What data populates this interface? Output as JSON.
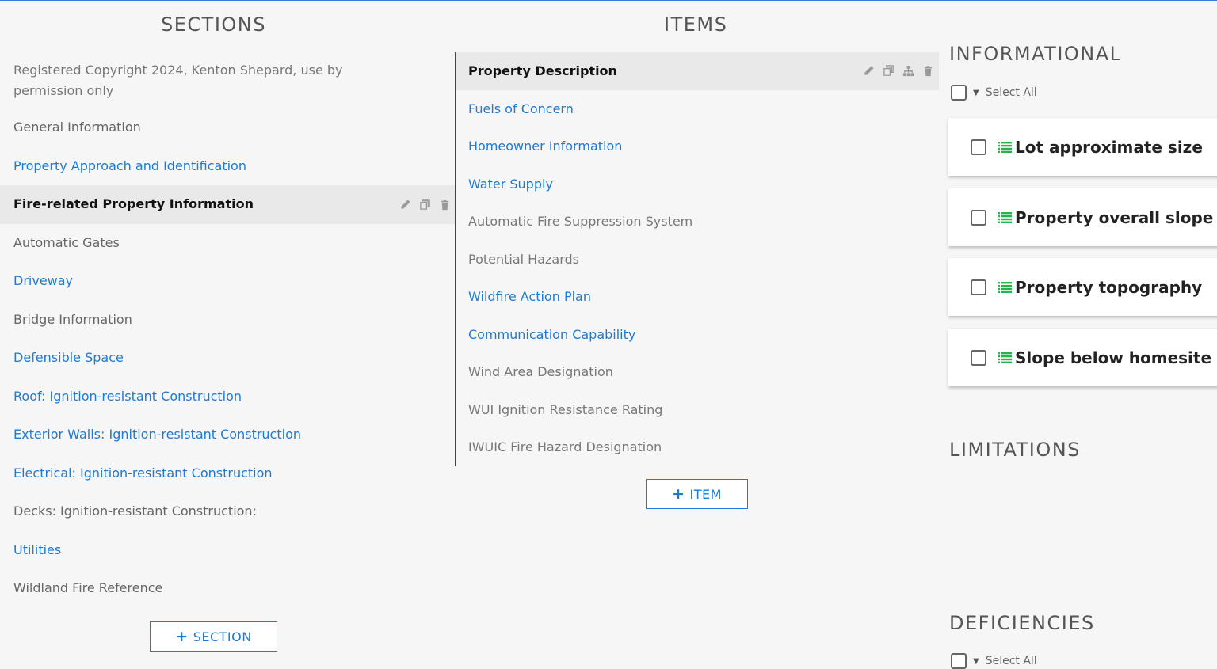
{
  "columns": {
    "sections_title": "SECTIONS",
    "items_title": "ITEMS"
  },
  "sections": [
    {
      "label": "Registered Copyright 2024, Kenton Shepard, use by permission only",
      "style": "copyright"
    },
    {
      "label": "General Information",
      "style": "plain"
    },
    {
      "label": "Property Approach and Identification",
      "style": "link"
    },
    {
      "label": "Fire-related Property Information",
      "style": "active"
    },
    {
      "label": "Automatic Gates",
      "style": "plain"
    },
    {
      "label": "Driveway",
      "style": "link"
    },
    {
      "label": "Bridge Information",
      "style": "plain"
    },
    {
      "label": "Defensible Space",
      "style": "link"
    },
    {
      "label": "Roof: Ignition-resistant Construction",
      "style": "link"
    },
    {
      "label": "Exterior Walls: Ignition-resistant Construction",
      "style": "link"
    },
    {
      "label": "Electrical: Ignition-resistant Construction",
      "style": "link"
    },
    {
      "label": "Decks: Ignition-resistant Construction:",
      "style": "plain"
    },
    {
      "label": "Utilities",
      "style": "link"
    },
    {
      "label": "Wildland Fire Reference",
      "style": "plain"
    }
  ],
  "add_section_label": "SECTION",
  "items": [
    {
      "label": "Property Description",
      "style": "active"
    },
    {
      "label": "Fuels of Concern",
      "style": "link"
    },
    {
      "label": "Homeowner Information",
      "style": "link"
    },
    {
      "label": "Water Supply",
      "style": "link"
    },
    {
      "label": "Automatic Fire Suppression System",
      "style": "plain"
    },
    {
      "label": "Potential Hazards",
      "style": "plain"
    },
    {
      "label": "Wildfire Action Plan",
      "style": "link"
    },
    {
      "label": "Communication Capability",
      "style": "link"
    },
    {
      "label": "Wind Area Designation",
      "style": "plain"
    },
    {
      "label": "WUI Ignition Resistance Rating",
      "style": "plain"
    },
    {
      "label": "IWUIC Fire Hazard Designation",
      "style": "plain"
    }
  ],
  "add_item_label": "ITEM",
  "informational": {
    "title": "INFORMATIONAL",
    "select_all": "Select All",
    "cards": [
      "Lot approximate size",
      "Property overall slope",
      "Property topography",
      "Slope below homesite"
    ]
  },
  "limitations": {
    "title": "LIMITATIONS"
  },
  "deficiencies": {
    "title": "DEFICIENCIES",
    "select_all": "Select All"
  },
  "colors": {
    "link": "#1e7ad2",
    "list_icon": "#2bb24c"
  }
}
